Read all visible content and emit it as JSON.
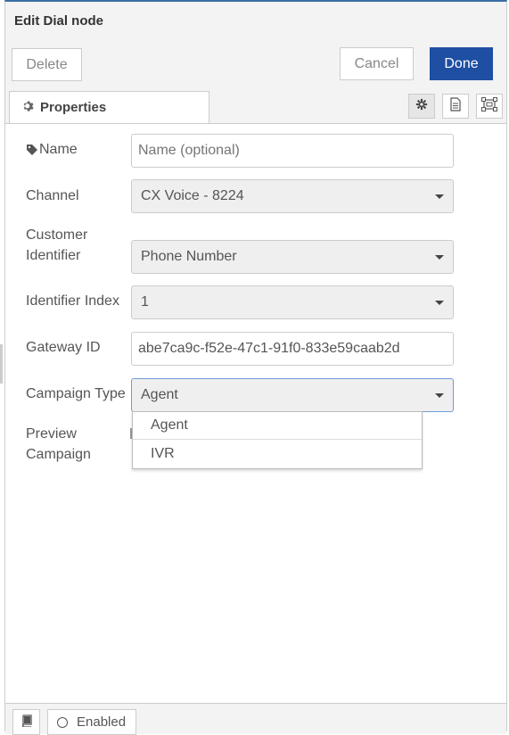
{
  "tray": {
    "title": "Edit Dial node"
  },
  "toolbar": {
    "delete_label": "Delete",
    "cancel_label": "Cancel",
    "done_label": "Done"
  },
  "tabs": {
    "properties_label": "Properties",
    "icons": [
      "gear-icon",
      "description-icon",
      "appearance-icon"
    ]
  },
  "form": {
    "name": {
      "label": "Name",
      "placeholder": "Name (optional)",
      "value": ""
    },
    "channel": {
      "label": "Channel",
      "value": "CX Voice - 8224"
    },
    "customer_identifier": {
      "label_line1": "Customer",
      "label_line2": "Identifier",
      "value": "Phone Number"
    },
    "identifier_index": {
      "label": "Identifier Index",
      "value": "1"
    },
    "gateway_id": {
      "label": "Gateway ID",
      "value": "abe7ca9c-f52e-47c1-91f0-833e59caab2d"
    },
    "campaign_type": {
      "label": "Campaign Type",
      "value": "Agent",
      "options": [
        "Agent",
        "IVR"
      ]
    },
    "preview_campaign": {
      "label_line1": "Preview",
      "label_line2": "Campaign"
    }
  },
  "footer": {
    "enabled_label": "Enabled"
  },
  "colors": {
    "accent": "#1f4fa3",
    "focus_border": "#6f9bd5"
  }
}
